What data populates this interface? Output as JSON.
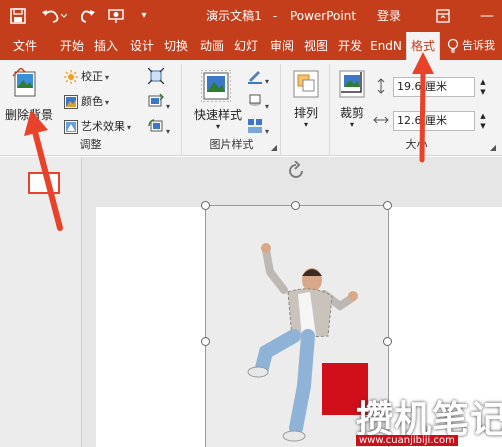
{
  "titlebar": {
    "doc_title": "演示文稿1",
    "separator": "-",
    "app_name": "PowerPoint",
    "login": "登录"
  },
  "tabs": [
    "文件",
    "开始",
    "插入",
    "设计",
    "切换",
    "动画",
    "幻灯",
    "审阅",
    "视图",
    "开发",
    "EndN",
    "格式"
  ],
  "tell_me": "告诉我",
  "ribbon": {
    "remove_bg": "删除背景",
    "corrections": "校正",
    "color": "颜色",
    "artistic": "艺术效果",
    "adjust_group": "调整",
    "quick_styles": "快速样式",
    "picture_styles_group": "图片样式",
    "arrange": "排列",
    "crop": "裁剪",
    "height_value": "19.6",
    "height_unit": "厘米",
    "width_value": "12.6",
    "width_unit": "厘米",
    "size_group": "大小"
  },
  "watermark": {
    "text": "攒机笔记",
    "url": "www.cuanjibiji.com"
  },
  "colors": {
    "accent": "#c43e1c",
    "arrow": "#e8432a"
  }
}
